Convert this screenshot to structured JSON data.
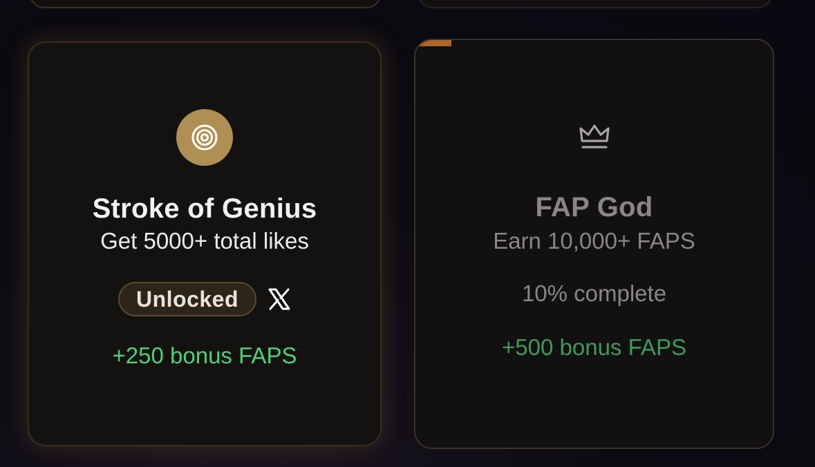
{
  "cards": [
    {
      "title": "Stroke of Genius",
      "description": "Get 5000+ total likes",
      "icon": "target-icon",
      "status": "Unlocked",
      "share_icon": "x-logo-icon",
      "reward": "+250 bonus FAPS",
      "accent_color": "#b08f55"
    },
    {
      "title": "FAP God",
      "description": "Earn 10,000+ FAPS",
      "icon": "crown-icon",
      "progress_text": "10% complete",
      "progress_fraction": 0.1,
      "reward": "+500 bonus FAPS",
      "accent_color": "#b06428"
    }
  ]
}
